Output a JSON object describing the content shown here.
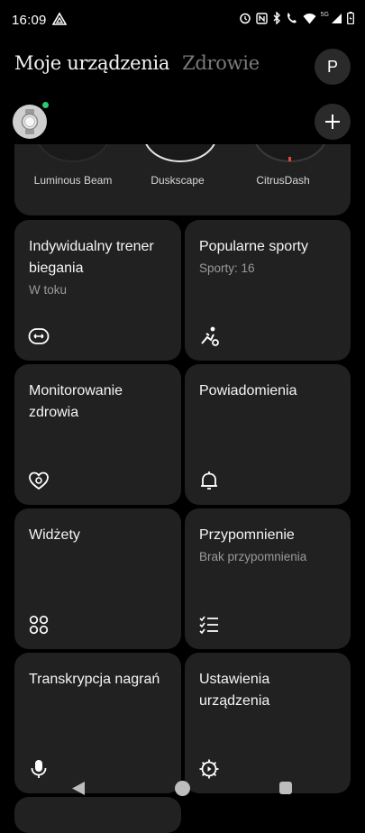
{
  "status_bar": {
    "time": "16:09",
    "network_label": "5G"
  },
  "header": {
    "tabs": [
      {
        "label": "Moje urządzenia",
        "active": true
      },
      {
        "label": "Zdrowie",
        "active": false
      }
    ],
    "profile_initial": "P"
  },
  "watch_faces": [
    {
      "name": "Luminous Beam"
    },
    {
      "name": "Duskscape"
    },
    {
      "name": "CitrusDash"
    }
  ],
  "cards": [
    {
      "title": "Indywidualny trener biegania",
      "subtitle": "W toku",
      "icon": "running-coach-icon"
    },
    {
      "title": "Popularne sporty",
      "subtitle": "Sporty: 16",
      "icon": "sports-icon"
    },
    {
      "title": "Monitorowanie zdrowia",
      "subtitle": "",
      "icon": "heart-health-icon"
    },
    {
      "title": "Powiadomienia",
      "subtitle": "",
      "icon": "bell-icon"
    },
    {
      "title": "Widżety",
      "subtitle": "",
      "icon": "widgets-icon"
    },
    {
      "title": "Przypomnienie",
      "subtitle": "Brak przypomnienia",
      "icon": "checklist-icon"
    },
    {
      "title": "Transkrypcja nagrań",
      "subtitle": "",
      "icon": "microphone-icon"
    },
    {
      "title": "Ustawienia urządzenia",
      "subtitle": "",
      "icon": "gear-icon"
    }
  ],
  "colors": {
    "background": "#000000",
    "card": "#212121",
    "status_online": "#2ecc71"
  }
}
